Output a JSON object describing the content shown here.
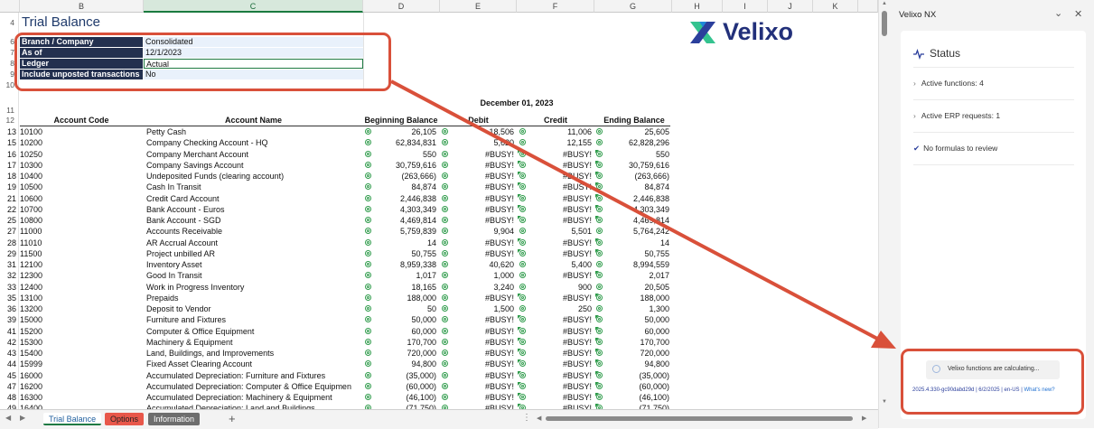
{
  "sheet": {
    "columns": [
      "B",
      "C",
      "D",
      "E",
      "F",
      "G",
      "H",
      "I",
      "J",
      "K"
    ],
    "selected_column": "C",
    "title": "Trial Balance",
    "params": [
      {
        "row": "6",
        "label": "Branch / Company",
        "value": "Consolidated"
      },
      {
        "row": "7",
        "label": "As of",
        "value": "12/1/2023"
      },
      {
        "row": "8",
        "label": "Ledger",
        "value": "Actual"
      },
      {
        "row": "9",
        "label": "Include unposted transactions",
        "value": "No"
      }
    ],
    "top_rows": [
      "4",
      "6",
      "7",
      "8",
      "9",
      "10",
      "11",
      "12"
    ],
    "report_date": "December 01, 2023",
    "col_headers": {
      "code": "Account Code",
      "name": "Account Name",
      "begin": "Beginning Balance",
      "debit": "Debit",
      "credit": "Credit",
      "end": "Ending Balance"
    },
    "rows": [
      {
        "row": "13",
        "code": "10100",
        "name": "Petty Cash",
        "begin": "26,105",
        "debit": "18,506",
        "credit": "11,006",
        "end": "25,605"
      },
      {
        "row": "15",
        "code": "10200",
        "name": "Company Checking Account - HQ",
        "begin": "62,834,831",
        "debit": "5,620",
        "credit": "12,155",
        "end": "62,828,296"
      },
      {
        "row": "16",
        "code": "10250",
        "name": "Company Merchant Account",
        "begin": "550",
        "debit": "#BUSY!",
        "credit": "#BUSY!",
        "end": "550"
      },
      {
        "row": "17",
        "code": "10300",
        "name": "Company Savings Account",
        "begin": "30,759,616",
        "debit": "#BUSY!",
        "credit": "#BUSY!",
        "end": "30,759,616"
      },
      {
        "row": "18",
        "code": "10400",
        "name": "Undeposited Funds (clearing account)",
        "begin": "(263,666)",
        "debit": "#BUSY!",
        "credit": "#BUSY!",
        "end": "(263,666)"
      },
      {
        "row": "19",
        "code": "10500",
        "name": "Cash In Transit",
        "begin": "84,874",
        "debit": "#BUSY!",
        "credit": "#BUSY!",
        "end": "84,874"
      },
      {
        "row": "21",
        "code": "10600",
        "name": "Credit Card Account",
        "begin": "2,446,838",
        "debit": "#BUSY!",
        "credit": "#BUSY!",
        "end": "2,446,838"
      },
      {
        "row": "22",
        "code": "10700",
        "name": "Bank Account - Euros",
        "begin": "4,303,349",
        "debit": "#BUSY!",
        "credit": "#BUSY!",
        "end": "4,303,349"
      },
      {
        "row": "25",
        "code": "10800",
        "name": "Bank Account - SGD",
        "begin": "4,469,814",
        "debit": "#BUSY!",
        "credit": "#BUSY!",
        "end": "4,469,814"
      },
      {
        "row": "27",
        "code": "11000",
        "name": "Accounts Receivable",
        "begin": "5,759,839",
        "debit": "9,904",
        "credit": "5,501",
        "end": "5,764,242"
      },
      {
        "row": "28",
        "code": "11010",
        "name": "AR Accrual Account",
        "begin": "14",
        "debit": "#BUSY!",
        "credit": "#BUSY!",
        "end": "14"
      },
      {
        "row": "29",
        "code": "11500",
        "name": "Project unbilled AR",
        "begin": "50,755",
        "debit": "#BUSY!",
        "credit": "#BUSY!",
        "end": "50,755"
      },
      {
        "row": "31",
        "code": "12100",
        "name": "Inventory Asset",
        "begin": "8,959,338",
        "debit": "40,620",
        "credit": "5,400",
        "end": "8,994,559"
      },
      {
        "row": "32",
        "code": "12300",
        "name": "Good In Transit",
        "begin": "1,017",
        "debit": "1,000",
        "credit": "#BUSY!",
        "end": "2,017"
      },
      {
        "row": "33",
        "code": "12400",
        "name": "Work in Progress Inventory",
        "begin": "18,165",
        "debit": "3,240",
        "credit": "900",
        "end": "20,505"
      },
      {
        "row": "35",
        "code": "13100",
        "name": "Prepaids",
        "begin": "188,000",
        "debit": "#BUSY!",
        "credit": "#BUSY!",
        "end": "188,000"
      },
      {
        "row": "36",
        "code": "13200",
        "name": "Deposit to Vendor",
        "begin": "50",
        "debit": "1,500",
        "credit": "250",
        "end": "1,300"
      },
      {
        "row": "39",
        "code": "15000",
        "name": "Furniture and Fixtures",
        "begin": "50,000",
        "debit": "#BUSY!",
        "credit": "#BUSY!",
        "end": "50,000"
      },
      {
        "row": "41",
        "code": "15200",
        "name": "Computer & Office Equipment",
        "begin": "60,000",
        "debit": "#BUSY!",
        "credit": "#BUSY!",
        "end": "60,000"
      },
      {
        "row": "42",
        "code": "15300",
        "name": "Machinery & Equipment",
        "begin": "170,700",
        "debit": "#BUSY!",
        "credit": "#BUSY!",
        "end": "170,700"
      },
      {
        "row": "43",
        "code": "15400",
        "name": "Land, Buildings, and Improvements",
        "begin": "720,000",
        "debit": "#BUSY!",
        "credit": "#BUSY!",
        "end": "720,000"
      },
      {
        "row": "44",
        "code": "15999",
        "name": "Fixed Asset Clearing Account",
        "begin": "94,800",
        "debit": "#BUSY!",
        "credit": "#BUSY!",
        "end": "94,800"
      },
      {
        "row": "45",
        "code": "16000",
        "name": "Accumulated Depreciation: Furniture and Fixtures",
        "begin": "(35,000)",
        "debit": "#BUSY!",
        "credit": "#BUSY!",
        "end": "(35,000)"
      },
      {
        "row": "47",
        "code": "16200",
        "name": "Accumulated Depreciation: Computer & Office Equipmen",
        "begin": "(60,000)",
        "debit": "#BUSY!",
        "credit": "#BUSY!",
        "end": "(60,000)"
      },
      {
        "row": "48",
        "code": "16300",
        "name": "Accumulated Depreciation: Machinery & Equipment",
        "begin": "(46,100)",
        "debit": "#BUSY!",
        "credit": "#BUSY!",
        "end": "(46,100)"
      },
      {
        "row": "49",
        "code": "16400",
        "name": "Accumulated Depreciation: Land and Buildings",
        "begin": "(71,750)",
        "debit": "#BUSY!",
        "credit": "#BUSY!",
        "end": "(71,750)"
      }
    ],
    "logo_text": "Velixo"
  },
  "tabs": [
    {
      "label": "Trial Balance",
      "active": true
    },
    {
      "label": "Options",
      "color": "#e8574a"
    },
    {
      "label": "Information",
      "color": "#6d6d6d"
    }
  ],
  "add_sheet": "+",
  "panel": {
    "title": "Velixo NX",
    "status_title": "Status",
    "items": [
      "Active functions: 4",
      "Active ERP requests: 1",
      "No formulas to review"
    ],
    "calculating": "Velixo functions are calculating...",
    "footer_version": "2025.4.330-gc90dabd29d | 6/2/2025 | en-US |",
    "footer_link": "What's new?"
  },
  "colors": {
    "accent": "#1f7a43",
    "annotation": "#d9503a",
    "panel_label": "#23304f",
    "logo_blue": "#2b3f9c",
    "logo_green": "#34c38f"
  }
}
